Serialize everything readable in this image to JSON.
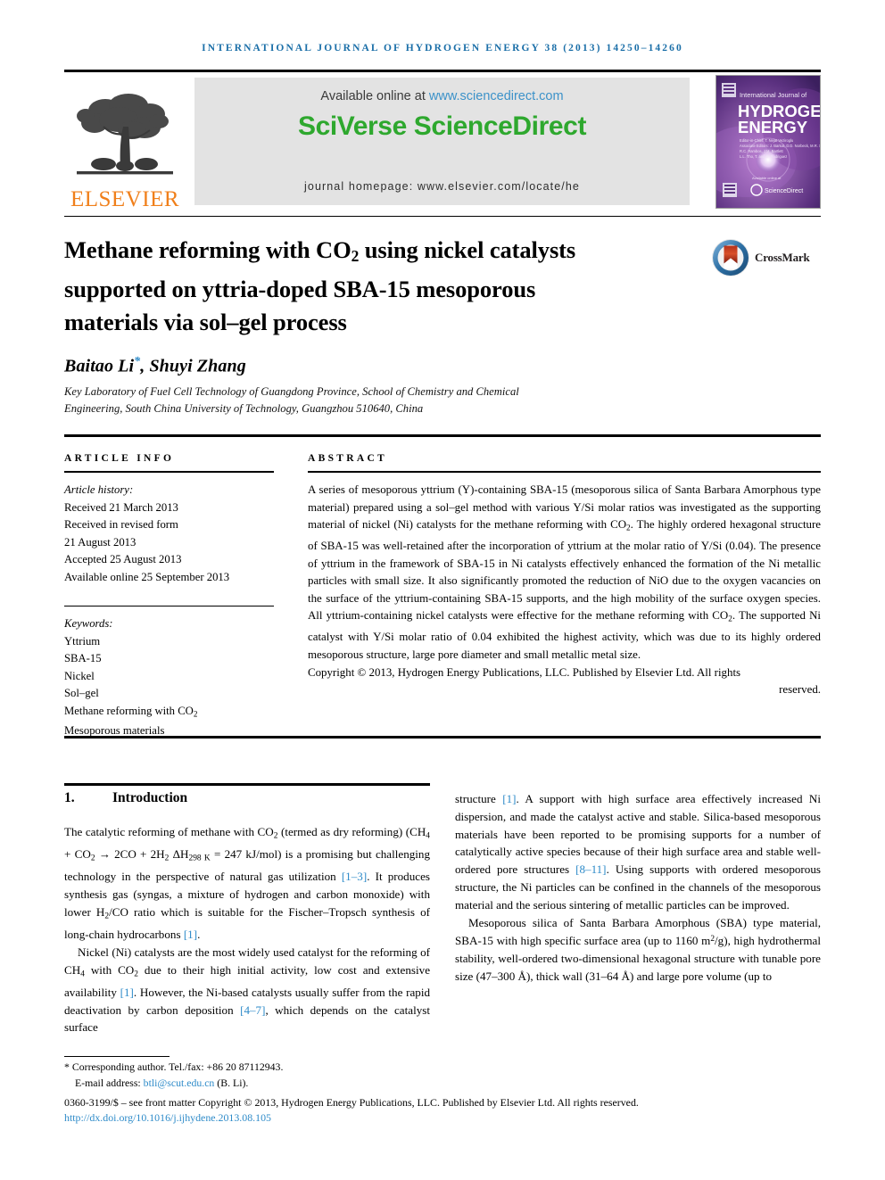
{
  "running_head": "International Journal of Hydrogen Energy 38 (2013) 14250–14260",
  "masthead": {
    "publisher_name": "ELSEVIER",
    "publisher_logo_alt": "elsevier-tree-logo",
    "available_prefix": "Available online at ",
    "available_link": "www.sciencedirect.com",
    "sciencedirect_logo": "SciVerse ScienceDirect",
    "journal_homepage": "journal homepage: www.elsevier.com/locate/he",
    "cover": {
      "line1": "International Journal of",
      "line2": "HYDROGEN",
      "line3": "ENERGY",
      "footer_logo": "ScienceDirect"
    }
  },
  "article": {
    "title_line1_a": "Methane reforming with CO",
    "title_line1_sub": "2",
    "title_line1_b": " using nickel catalysts",
    "title_line2": "supported on yttria-doped SBA-15 mesoporous",
    "title_line3": "materials via sol–gel process",
    "crossmark_label": "CrossMark",
    "authors": "Baitao Li",
    "author_marker": "*",
    "authors_rest": ", Shuyi Zhang",
    "affiliation": "Key Laboratory of Fuel Cell Technology of Guangdong Province, School of Chemistry and Chemical Engineering, South China University of Technology, Guangzhou 510640, China"
  },
  "info": {
    "heading": "Article info",
    "history_label": "Article history:",
    "history": [
      "Received 21 March 2013",
      "Received in revised form",
      "21 August 2013",
      "Accepted 25 August 2013",
      "Available online 25 September 2013"
    ],
    "keywords_label": "Keywords:",
    "keywords": [
      "Yttrium",
      "SBA-15",
      "Nickel",
      "Sol–gel",
      "Methane reforming with CO2",
      "Mesoporous materials"
    ]
  },
  "abstract": {
    "heading": "Abstract",
    "text": "A series of mesoporous yttrium (Y)-containing SBA-15 (mesoporous silica of Santa Barbara Amorphous type material) prepared using a sol–gel method with various Y/Si molar ratios was investigated as the supporting material of nickel (Ni) catalysts for the methane reforming with CO2. The highly ordered hexagonal structure of SBA-15 was well-retained after the incorporation of yttrium at the molar ratio of Y/Si (0.04). The presence of yttrium in the framework of SBA-15 in Ni catalysts effectively enhanced the formation of the Ni metallic particles with small size. It also significantly promoted the reduction of NiO due to the oxygen vacancies on the surface of the yttrium-containing SBA-15 supports, and the high mobility of the surface oxygen species. All yttrium-containing nickel catalysts were effective for the methane reforming with CO2. The supported Ni catalyst with Y/Si molar ratio of 0.04 exhibited the highest activity, which was due to its highly ordered mesoporous structure, large pore diameter and small metallic metal size.",
    "copyright": "Copyright © 2013, Hydrogen Energy Publications, LLC. Published by Elsevier Ltd. All rights",
    "copyright_last": "reserved."
  },
  "body": {
    "section_number": "1.",
    "section_title": "Introduction",
    "left_paragraph_1": "The catalytic reforming of methane with CO2 (termed as dry reforming) (CH4 + CO2 → 2CO + 2H2 ΔH298 K = 247 kJ/mol) is a promising but challenging technology in the perspective of natural gas utilization [1–3]. It produces synthesis gas (syngas, a mixture of hydrogen and carbon monoxide) with lower H2/CO ratio which is suitable for the Fischer–Tropsch synthesis of long-chain hydrocarbons [1].",
    "left_paragraph_2": "Nickel (Ni) catalysts are the most widely used catalyst for the reforming of CH4 with CO2 due to their high initial activity, low cost and extensive availability [1]. However, the Ni-based catalysts usually suffer from the rapid deactivation by carbon deposition [4–7], which depends on the catalyst surface",
    "right_paragraph_1": "structure [1]. A support with high surface area effectively increased Ni dispersion, and made the catalyst active and stable. Silica-based mesoporous materials have been reported to be promising supports for a number of catalytically active species because of their high surface area and stable well-ordered pore structures [8–11]. Using supports with ordered mesoporous structure, the Ni particles can be confined in the channels of the mesoporous material and the serious sintering of metallic particles can be improved.",
    "right_paragraph_2": "Mesoporous silica of Santa Barbara Amorphous (SBA) type material, SBA-15 with high specific surface area (up to 1160 m2/g), high hydrothermal stability, well-ordered two-dimensional hexagonal structure with tunable pore size (47–300 Å), thick wall (31–64 Å) and large pore volume (up to"
  },
  "footer": {
    "corresponding_marker": "*",
    "corresponding_text": "Corresponding author. Tel./fax: +86 20 87112943.",
    "email_label": "E-mail address: ",
    "email": "btli@scut.edu.cn",
    "email_suffix": " (B. Li).",
    "issn_line": "0360-3199/$ – see front matter Copyright © 2013, Hydrogen Energy Publications, LLC. Published by Elsevier Ltd. All rights reserved.",
    "doi": "http://dx.doi.org/10.1016/j.ijhydene.2013.08.105"
  },
  "colors": {
    "link_blue": "#2E8BC9",
    "header_blue": "#1B6FA8",
    "elsevier_orange": "#F07F1A",
    "sciencedirect_green": "#2EA82E",
    "banner_gray": "#E3E3E3"
  }
}
